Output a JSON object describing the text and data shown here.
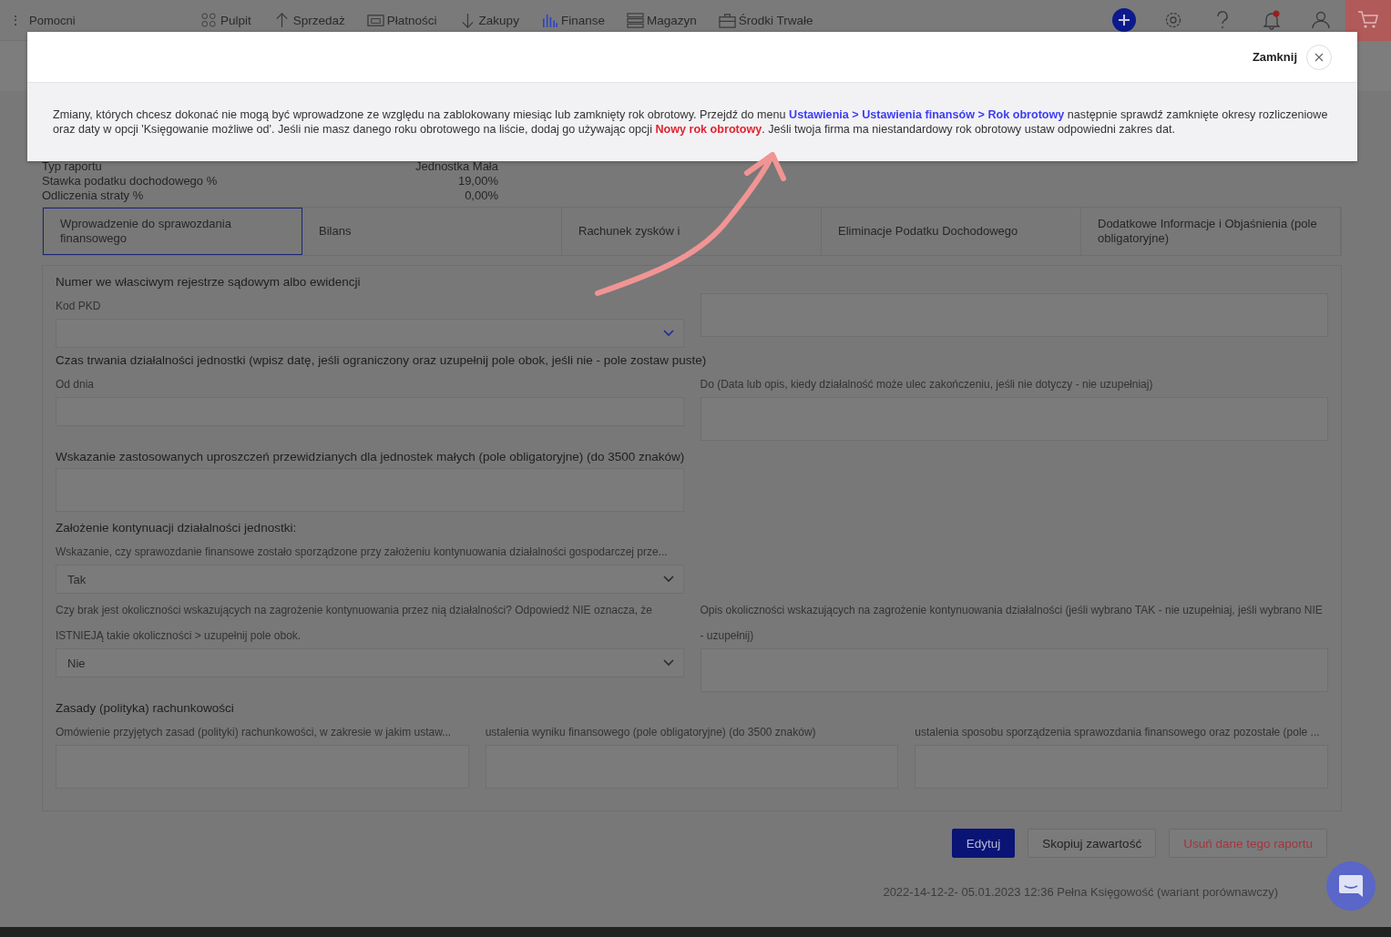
{
  "nav": {
    "menu_icon": "⋮",
    "menu": "Pomocni",
    "items": [
      {
        "label": "Pulpit",
        "kind": "grid",
        "selected": false
      },
      {
        "label": "Sprzedaż",
        "kind": "up",
        "selected": false
      },
      {
        "label": "Płatności",
        "kind": "cash",
        "selected": false
      },
      {
        "label": "Zakupy",
        "kind": "down",
        "selected": false
      },
      {
        "label": "Finanse",
        "kind": "bars",
        "selected": true
      },
      {
        "label": "Magazyn",
        "kind": "stack",
        "selected": false
      },
      {
        "label": "Środki Trwałe",
        "kind": "case",
        "selected": false
      }
    ],
    "notification": true
  },
  "modal": {
    "close": "Zamknij",
    "message": [
      {
        "kind": "text",
        "text": "Zmiany, których chcesz dokonać nie mogą być wprowadzone ze względu na zablokowany miesiąc lub zamknięty rok obrotowy. Przejdź do menu "
      },
      {
        "kind": "link",
        "text": "Ustawienia > Ustawienia finansów > Rok obrotowy",
        "color": "#3d3df5"
      },
      {
        "kind": "text",
        "text": " następnie sprawdź zamknięte okresy rozliczeniowe oraz daty w opcji 'Księgowanie możliwe od'. Jeśli nie masz danego roku obrotowego na liście, dodaj go używając opcji "
      },
      {
        "kind": "link",
        "text": "Nowy rok obrotowy",
        "color": "#e0242f"
      },
      {
        "kind": "text",
        "text": ". Jeśli twoja firma ma niestandardowy rok obrotowy ustaw odpowiedni zakres dat."
      }
    ]
  },
  "info": [
    {
      "label": "Typ raportu",
      "value": "Jednostka Mała"
    },
    {
      "label": "Stawka podatku dochodowego %",
      "value": "19,00%"
    },
    {
      "label": "Odliczenia straty %",
      "value": "0,00%"
    }
  ],
  "tabs": [
    {
      "label": "Wprowadzenie do sprawozdania finansowego",
      "selected": true
    },
    {
      "label": "Bilans",
      "selected": false
    },
    {
      "label": "Rachunek zysków i",
      "selected": false
    },
    {
      "label": "Eliminacje Podatku Dochodowego",
      "selected": false
    },
    {
      "label": "Dodatkowe Informacje i Objaśnienia (pole obligatoryjne)",
      "selected": false
    }
  ],
  "sections": [
    {
      "title": "Numer we własciwym rejestrze sądowym albo ewidencji",
      "rows": [
        [
          {
            "kind": "select",
            "label": "Kod PKD",
            "accent": true
          },
          {
            "kind": "textarea"
          }
        ]
      ]
    },
    {
      "title": "Czas trwania działalności jednostki (wpisz datę, jeśli ograniczony oraz uzupełnij pole obok, jeśli nie - pole zostaw puste)",
      "rows": [
        [
          {
            "kind": "input",
            "label": "Od dnia"
          },
          {
            "kind": "textarea",
            "label": "Do (Data lub opis, kiedy działalność może ulec zakończeniu, jeśli nie dotyczy - nie uzupełniaj)"
          }
        ]
      ]
    },
    {
      "title": "Wskazanie zastosowanych uproszczeń przewidzianych dla jednostek małych (pole obligatoryjne) (do 3500 znaków)",
      "rows": [
        [
          {
            "kind": "textarea"
          }
        ]
      ]
    },
    {
      "title": "Założenie kontynuacji działalności jednostki:",
      "rows": [
        [
          {
            "kind": "select",
            "label": "Wskazanie, czy sprawozdanie finansowe zostało sporządzone przy założeniu kontynuowania działalności gospodarczej prze...",
            "value": "Tak"
          }
        ],
        [
          {
            "kind": "select",
            "label": "Czy brak jest okoliczności wskazujących na zagrożenie kontynuowania przez nią działalności? Odpowiedź NIE oznacza, że ISTNIEJĄ takie okoliczności > uzupełnij pole obok.",
            "value": "Nie"
          },
          {
            "kind": "textarea",
            "label": "Opis okoliczności wskazujących na zagrożenie kontynuowania działalności (jeśli wybrano TAK - nie uzupełniaj, jeśli wybrano NIE - uzupełnij)"
          }
        ]
      ]
    },
    {
      "title": "Zasady (polityka) rachunkowości",
      "rows": [
        [
          {
            "kind": "textarea",
            "label": "Omówienie przyjętych zasad (polityki) rachunkowości, w zakresie w jakim ustaw..."
          },
          {
            "kind": "textarea",
            "label": "ustalenia wyniku finansowego (pole obligatoryjne) (do 3500 znaków)"
          },
          {
            "kind": "textarea",
            "label": "ustalenia sposobu sporządzenia sprawozdania finansowego oraz pozostałe (pole ..."
          }
        ]
      ]
    }
  ],
  "actions": [
    {
      "label": "Edytuj",
      "kind": "primary"
    },
    {
      "label": "Skopiuj zawartość",
      "kind": "default"
    },
    {
      "label": "Usuń dane tego raportu",
      "kind": "danger"
    }
  ],
  "footer": "2022-14-12-2- 05.01.2023 12:36 Pełna Księgowość (wariant porównawczy)"
}
